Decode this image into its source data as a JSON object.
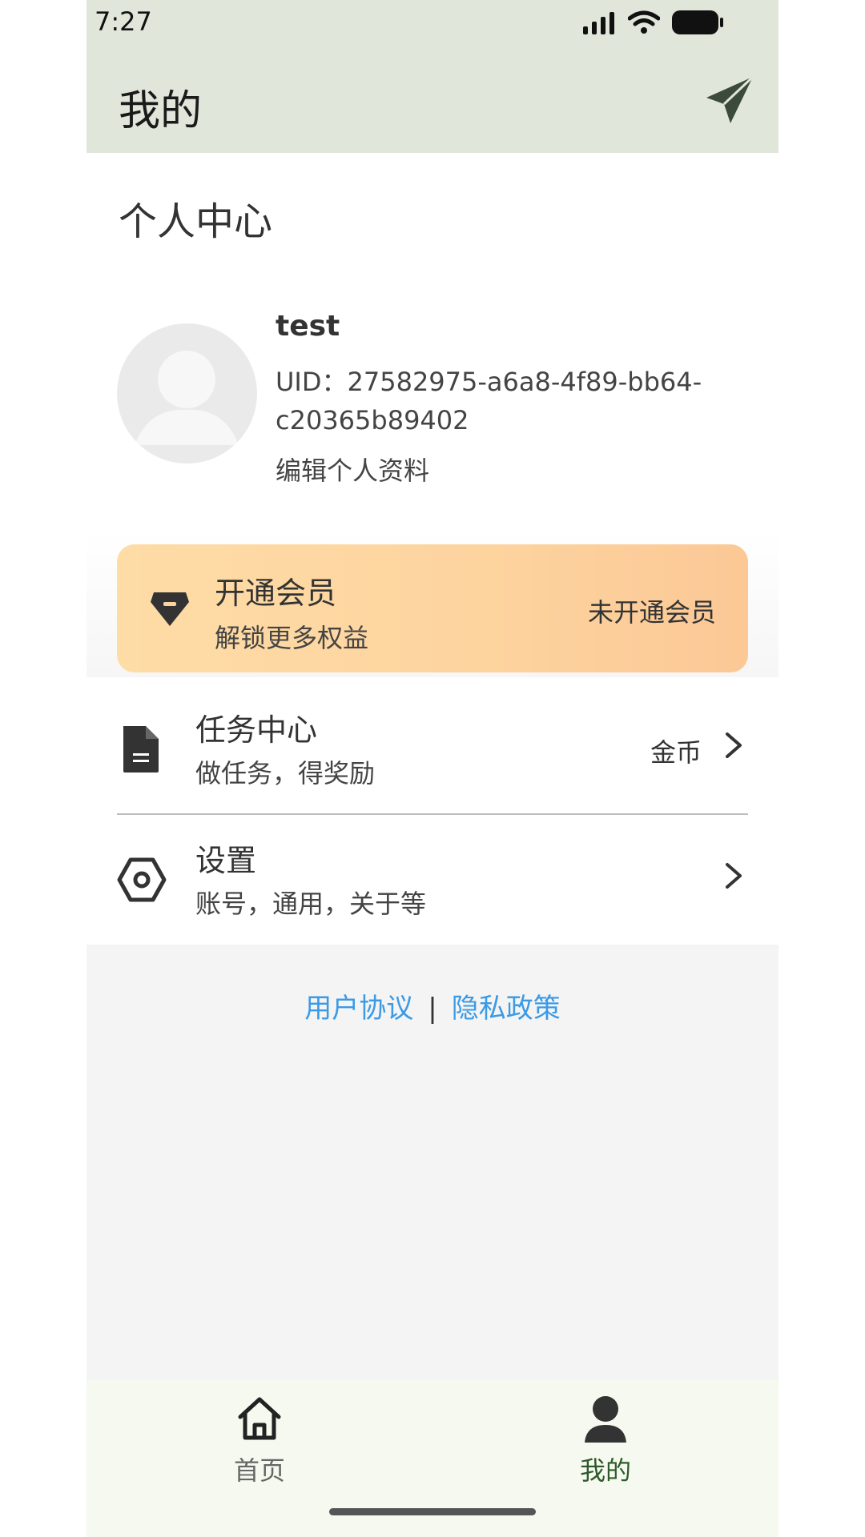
{
  "status_bar": {
    "time": "7:27",
    "icons": [
      "signal-icon",
      "wifi-icon",
      "battery-icon"
    ]
  },
  "header": {
    "title": "我的",
    "action_icon": "send-icon"
  },
  "profile": {
    "section_title": "个人中心",
    "username": "test",
    "uid": "UID：27582975-a6a8-4f89-bb64-c20365b89402",
    "edit_label": "编辑个人资料",
    "avatar_icon": "avatar-placeholder-icon"
  },
  "membership": {
    "title": "开通会员",
    "subtitle": "解锁更多权益",
    "status": "未开通会员",
    "icon": "vip-diamond-icon"
  },
  "menu": [
    {
      "title": "任务中心",
      "subtitle": "做任务，得奖励",
      "right_text": "金币",
      "icon": "document-icon"
    },
    {
      "title": "设置",
      "subtitle": "账号，通用，关于等",
      "right_text": "",
      "icon": "settings-hex-icon"
    }
  ],
  "footer_links": {
    "user_agreement": "用户协议",
    "separator": "|",
    "privacy_policy": "隐私政策"
  },
  "bottom_nav": {
    "items": [
      {
        "label": "首页",
        "icon": "home-icon",
        "active": false
      },
      {
        "label": "我的",
        "icon": "user-icon",
        "active": true
      }
    ]
  },
  "colors": {
    "app_bar": "#e0e6da",
    "member_gradient_start": "#fedca6",
    "member_gradient_end": "#fbc896",
    "link": "#3b9ae6",
    "nav_active": "#2e5b2a"
  }
}
